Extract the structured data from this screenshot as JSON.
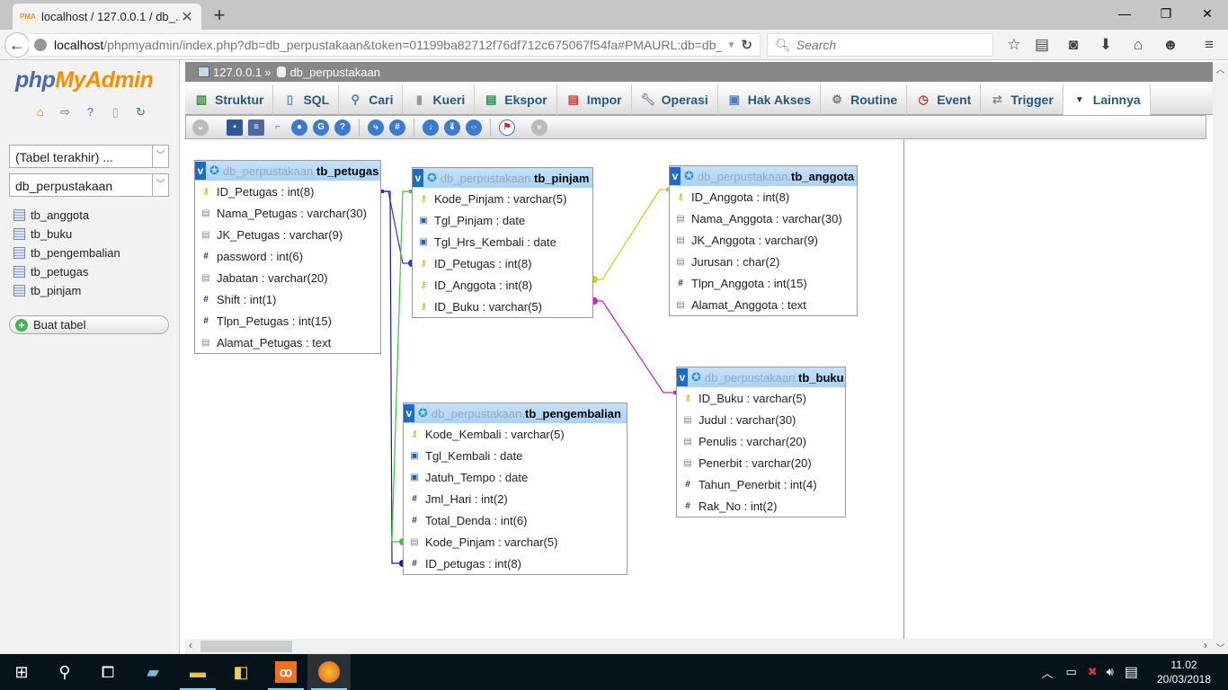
{
  "browser": {
    "tab_title": "localhost / 127.0.0.1 / db_...",
    "url_host": "localhost",
    "url_path": "/phpmyadmin/index.php?db=db_perpustakaan&token=01199ba82712f76df712c675067f54fa#PMAURL:db=db_",
    "search_placeholder": "Search"
  },
  "sidebar": {
    "logo_php": "php",
    "logo_myadmin": "MyAdmin",
    "recent_select": "(Tabel terakhir) ...",
    "db_select": "db_perpustakaan",
    "tables": [
      "tb_anggota",
      "tb_buku",
      "tb_pengembalian",
      "tb_petugas",
      "tb_pinjam"
    ],
    "new_table": "Buat tabel"
  },
  "breadcrumb": {
    "server": "127.0.0.1",
    "sep": "»",
    "database": "db_perpustakaan"
  },
  "tabs": [
    {
      "label": "Struktur",
      "icon": "structure-icon"
    },
    {
      "label": "SQL",
      "icon": "sql-icon"
    },
    {
      "label": "Cari",
      "icon": "search-icon"
    },
    {
      "label": "Kueri",
      "icon": "query-icon"
    },
    {
      "label": "Ekspor",
      "icon": "export-icon"
    },
    {
      "label": "Impor",
      "icon": "import-icon"
    },
    {
      "label": "Operasi",
      "icon": "wrench-icon"
    },
    {
      "label": "Hak Akses",
      "icon": "privileges-icon"
    },
    {
      "label": "Routine",
      "icon": "routine-icon"
    },
    {
      "label": "Event",
      "icon": "event-icon"
    },
    {
      "label": "Trigger",
      "icon": "trigger-icon"
    },
    {
      "label": "Lainnya",
      "icon": "dropdown-triangle-icon"
    }
  ],
  "designer": {
    "db_prefix": "db_perpustakaan.",
    "tables": {
      "tb_petugas": {
        "name": "tb_petugas",
        "fields": [
          {
            "name": "ID_Petugas",
            "type": "int(8)",
            "kind": "key"
          },
          {
            "name": "Nama_Petugas",
            "type": "varchar(30)",
            "kind": "str"
          },
          {
            "name": "JK_Petugas",
            "type": "varchar(9)",
            "kind": "str"
          },
          {
            "name": "password",
            "type": "int(6)",
            "kind": "num"
          },
          {
            "name": "Jabatan",
            "type": "varchar(20)",
            "kind": "str"
          },
          {
            "name": "Shift",
            "type": "int(1)",
            "kind": "num"
          },
          {
            "name": "Tlpn_Petugas",
            "type": "int(15)",
            "kind": "num"
          },
          {
            "name": "Alamat_Petugas",
            "type": "text",
            "kind": "str"
          }
        ]
      },
      "tb_pinjam": {
        "name": "tb_pinjam",
        "fields": [
          {
            "name": "Kode_Pinjam",
            "type": "varchar(5)",
            "kind": "key"
          },
          {
            "name": "Tgl_Pinjam",
            "type": "date",
            "kind": "date"
          },
          {
            "name": "Tgl_Hrs_Kembali",
            "type": "date",
            "kind": "date"
          },
          {
            "name": "ID_Petugas",
            "type": "int(8)",
            "kind": "key"
          },
          {
            "name": "ID_Anggota",
            "type": "int(8)",
            "kind": "key"
          },
          {
            "name": "ID_Buku",
            "type": "varchar(5)",
            "kind": "key"
          }
        ]
      },
      "tb_anggota": {
        "name": "tb_anggota",
        "fields": [
          {
            "name": "ID_Anggota",
            "type": "int(8)",
            "kind": "key"
          },
          {
            "name": "Nama_Anggota",
            "type": "varchar(30)",
            "kind": "str"
          },
          {
            "name": "JK_Anggota",
            "type": "varchar(9)",
            "kind": "str"
          },
          {
            "name": "Jurusan",
            "type": "char(2)",
            "kind": "str"
          },
          {
            "name": "Tlpn_Anggota",
            "type": "int(15)",
            "kind": "num"
          },
          {
            "name": "Alamat_Anggota",
            "type": "text",
            "kind": "str"
          }
        ]
      },
      "tb_pengembalian": {
        "name": "tb_pengembalian",
        "fields": [
          {
            "name": "Kode_Kembali",
            "type": "varchar(5)",
            "kind": "key"
          },
          {
            "name": "Tgl_Kembali",
            "type": "date",
            "kind": "date"
          },
          {
            "name": "Jatuh_Tempo",
            "type": "date",
            "kind": "date"
          },
          {
            "name": "Jml_Hari",
            "type": "int(2)",
            "kind": "num"
          },
          {
            "name": "Total_Denda",
            "type": "int(6)",
            "kind": "num"
          },
          {
            "name": "Kode_Pinjam",
            "type": "varchar(5)",
            "kind": "str"
          },
          {
            "name": "ID_petugas",
            "type": "int(8)",
            "kind": "num"
          }
        ]
      },
      "tb_buku": {
        "name": "tb_buku",
        "fields": [
          {
            "name": "ID_Buku",
            "type": "varchar(5)",
            "kind": "key"
          },
          {
            "name": "Judul",
            "type": "varchar(30)",
            "kind": "str"
          },
          {
            "name": "Penulis",
            "type": "varchar(20)",
            "kind": "str"
          },
          {
            "name": "Penerbit",
            "type": "varchar(20)",
            "kind": "str"
          },
          {
            "name": "Tahun_Penerbit",
            "type": "int(4)",
            "kind": "num"
          },
          {
            "name": "Rak_No",
            "type": "int(2)",
            "kind": "num"
          }
        ]
      }
    },
    "relations": [
      {
        "from": "tb_petugas.ID_Petugas",
        "to": "tb_pinjam.ID_Petugas",
        "color": "#3333cc"
      },
      {
        "from": "tb_petugas.ID_Petugas",
        "to": "tb_pengembalian.ID_petugas",
        "color": "#1a1aa0"
      },
      {
        "from": "tb_pinjam.Kode_Pinjam",
        "to": "tb_pengembalian.Kode_Pinjam",
        "color": "#33cc33"
      },
      {
        "from": "tb_anggota.ID_Anggota",
        "to": "tb_pinjam.ID_Anggota",
        "color": "#cccc22"
      },
      {
        "from": "tb_buku.ID_Buku",
        "to": "tb_pinjam.ID_Buku",
        "color": "#cc22cc"
      }
    ]
  },
  "taskbar": {
    "time": "11.02",
    "date": "20/03/2018"
  }
}
